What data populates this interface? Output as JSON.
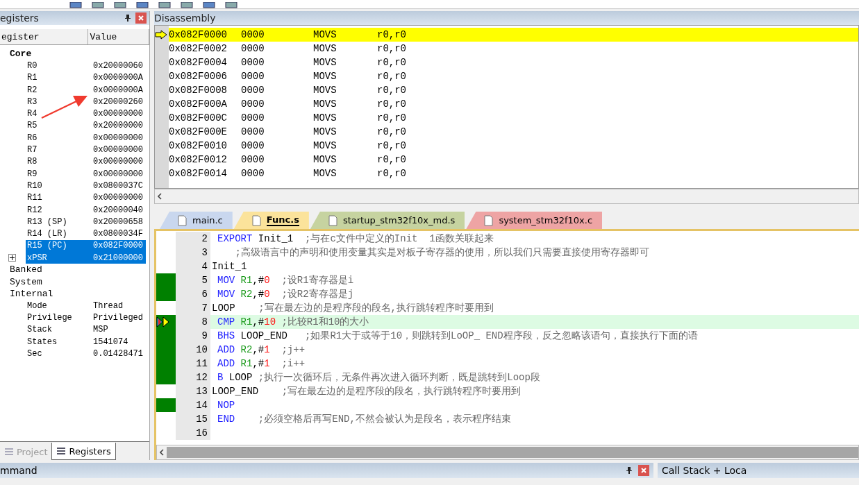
{
  "registers_panel": {
    "title": "egisters",
    "columns": [
      "egister",
      "Value"
    ],
    "groups": [
      {
        "name": "Core",
        "bold": true,
        "children": [
          {
            "name": "R0",
            "value": "0x20000060",
            "selected": false
          },
          {
            "name": "R1",
            "value": "0x0000000A",
            "selected": false
          },
          {
            "name": "R2",
            "value": "0x0000000A",
            "selected": false
          },
          {
            "name": "R3",
            "value": "0x20000260",
            "selected": false
          },
          {
            "name": "R4",
            "value": "0x00000000",
            "selected": false
          },
          {
            "name": "R5",
            "value": "0x20000000",
            "selected": false
          },
          {
            "name": "R6",
            "value": "0x00000000",
            "selected": false
          },
          {
            "name": "R7",
            "value": "0x00000000",
            "selected": false
          },
          {
            "name": "R8",
            "value": "0x00000000",
            "selected": false
          },
          {
            "name": "R9",
            "value": "0x00000000",
            "selected": false
          },
          {
            "name": "R10",
            "value": "0x0800037C",
            "selected": false
          },
          {
            "name": "R11",
            "value": "0x00000000",
            "selected": false
          },
          {
            "name": "R12",
            "value": "0x20000040",
            "selected": false
          },
          {
            "name": "R13 (SP)",
            "value": "0x20000658",
            "selected": false
          },
          {
            "name": "R14 (LR)",
            "value": "0x0800034F",
            "selected": false
          },
          {
            "name": "R15 (PC)",
            "value": "0x082F0000",
            "selected": true
          },
          {
            "name": "xPSR",
            "value": "0x21000000",
            "selected": true,
            "expanded": false
          }
        ]
      },
      {
        "name": "Banked",
        "bold": false
      },
      {
        "name": "System",
        "bold": false
      },
      {
        "name": "Internal",
        "bold": false,
        "children": [
          {
            "name": "Mode",
            "value": "Thread",
            "selected": false
          },
          {
            "name": "Privilege",
            "value": "Privileged",
            "selected": false
          },
          {
            "name": "Stack",
            "value": "MSP",
            "selected": false
          },
          {
            "name": "States",
            "value": "1541074",
            "selected": false
          },
          {
            "name": "Sec",
            "value": "0.01428471",
            "selected": false
          }
        ]
      }
    ],
    "tabs": [
      {
        "label": "Project",
        "selected": false,
        "disabled": true
      },
      {
        "label": "Registers",
        "selected": true,
        "disabled": false
      }
    ]
  },
  "disassembly": {
    "title": "Disassembly",
    "rows": [
      {
        "address": "0x082F0000",
        "code": "0000",
        "mnemonic": "MOVS",
        "operands": "r0,r0",
        "current": true
      },
      {
        "address": "0x082F0002",
        "code": "0000",
        "mnemonic": "MOVS",
        "operands": "r0,r0",
        "current": false
      },
      {
        "address": "0x082F0004",
        "code": "0000",
        "mnemonic": "MOVS",
        "operands": "r0,r0",
        "current": false
      },
      {
        "address": "0x082F0006",
        "code": "0000",
        "mnemonic": "MOVS",
        "operands": "r0,r0",
        "current": false
      },
      {
        "address": "0x082F0008",
        "code": "0000",
        "mnemonic": "MOVS",
        "operands": "r0,r0",
        "current": false
      },
      {
        "address": "0x082F000A",
        "code": "0000",
        "mnemonic": "MOVS",
        "operands": "r0,r0",
        "current": false
      },
      {
        "address": "0x082F000C",
        "code": "0000",
        "mnemonic": "MOVS",
        "operands": "r0,r0",
        "current": false
      },
      {
        "address": "0x082F000E",
        "code": "0000",
        "mnemonic": "MOVS",
        "operands": "r0,r0",
        "current": false
      },
      {
        "address": "0x082F0010",
        "code": "0000",
        "mnemonic": "MOVS",
        "operands": "r0,r0",
        "current": false
      },
      {
        "address": "0x082F0012",
        "code": "0000",
        "mnemonic": "MOVS",
        "operands": "r0,r0",
        "current": false
      },
      {
        "address": "0x082F0014",
        "code": "0000",
        "mnemonic": "MOVS",
        "operands": "r0,r0",
        "current": false
      }
    ]
  },
  "editor_tabs": [
    {
      "label": "main.c",
      "color": "#c9d7ee",
      "selected": false
    },
    {
      "label": "Func.s",
      "color": "#fbe39b",
      "selected": true
    },
    {
      "label": "startup_stm32f10x_md.s",
      "color": "#c6d3a0",
      "selected": false
    },
    {
      "label": "system_stm32f10x.c",
      "color": "#eea4a4",
      "selected": false
    }
  ],
  "editor": {
    "lines": [
      {
        "number": "2",
        "indented": true,
        "covered": false,
        "current": false,
        "segments": [
          {
            "kind": "keyword",
            "text": "EXPORT"
          },
          {
            "kind": "plain",
            "text": " Init_1  "
          },
          {
            "kind": "comment",
            "text": ";与在c文件中定义的Init  1函数关联起来"
          }
        ]
      },
      {
        "number": "3",
        "indented": false,
        "covered": false,
        "current": false,
        "segments": [
          {
            "kind": "comment",
            "text": "    ;高级语言中的声明和使用变量其实是对板子寄存器的使用，所以我们只需要直接使用寄存器即可"
          }
        ]
      },
      {
        "number": "4",
        "indented": false,
        "covered": false,
        "current": false,
        "segments": [
          {
            "kind": "plain",
            "text": "Init_1"
          }
        ]
      },
      {
        "number": "5",
        "indented": true,
        "covered": true,
        "current": false,
        "segments": [
          {
            "kind": "keyword",
            "text": "MOV"
          },
          {
            "kind": "register",
            "text": " R1"
          },
          {
            "kind": "plain",
            "text": ",#"
          },
          {
            "kind": "number",
            "text": "0"
          },
          {
            "kind": "comment",
            "text": "  ;设R1寄存器是i"
          }
        ]
      },
      {
        "number": "6",
        "indented": true,
        "covered": true,
        "current": false,
        "segments": [
          {
            "kind": "keyword",
            "text": "MOV"
          },
          {
            "kind": "register",
            "text": " R2"
          },
          {
            "kind": "plain",
            "text": ",#"
          },
          {
            "kind": "number",
            "text": "0"
          },
          {
            "kind": "comment",
            "text": "  ;设R2寄存器是j"
          }
        ]
      },
      {
        "number": "7",
        "indented": false,
        "covered": false,
        "current": false,
        "segments": [
          {
            "kind": "plain",
            "text": "LOOP    "
          },
          {
            "kind": "comment",
            "text": ";写在最左边的是程序段的段名,执行跳转程序时要用到"
          }
        ]
      },
      {
        "number": "8",
        "indented": true,
        "covered": true,
        "current": true,
        "segments": [
          {
            "kind": "keyword",
            "text": "CMP"
          },
          {
            "kind": "register",
            "text": " R1"
          },
          {
            "kind": "plain",
            "text": ",#"
          },
          {
            "kind": "number",
            "text": "10"
          },
          {
            "kind": "comment",
            "text": " ;比较R1和10的大小"
          }
        ]
      },
      {
        "number": "9",
        "indented": true,
        "covered": true,
        "current": false,
        "segments": [
          {
            "kind": "keyword",
            "text": "BHS"
          },
          {
            "kind": "plain",
            "text": " LOOP_END   "
          },
          {
            "kind": "comment",
            "text": ";如果R1大于或等于10，则跳转到LoOP_ END程序段，反之忽略该语句，直接执行下面的语"
          }
        ]
      },
      {
        "number": "10",
        "indented": true,
        "covered": true,
        "current": false,
        "segments": [
          {
            "kind": "keyword",
            "text": "ADD"
          },
          {
            "kind": "register",
            "text": " R2"
          },
          {
            "kind": "plain",
            "text": ",#"
          },
          {
            "kind": "number",
            "text": "1"
          },
          {
            "kind": "comment",
            "text": "  ;j++"
          }
        ]
      },
      {
        "number": "11",
        "indented": true,
        "covered": true,
        "current": false,
        "segments": [
          {
            "kind": "keyword",
            "text": "ADD"
          },
          {
            "kind": "register",
            "text": " R1"
          },
          {
            "kind": "plain",
            "text": ",#"
          },
          {
            "kind": "number",
            "text": "1"
          },
          {
            "kind": "comment",
            "text": "  ;i++"
          }
        ]
      },
      {
        "number": "12",
        "indented": true,
        "covered": true,
        "current": false,
        "segments": [
          {
            "kind": "keyword",
            "text": "B"
          },
          {
            "kind": "plain",
            "text": " LOOP "
          },
          {
            "kind": "comment",
            "text": ";执行一次循环后，无条件再次进入循环判断，既是跳转到Loop段"
          }
        ]
      },
      {
        "number": "13",
        "indented": false,
        "covered": false,
        "current": false,
        "segments": [
          {
            "kind": "plain",
            "text": "LOOP_END    "
          },
          {
            "kind": "comment",
            "text": ";写在最左边的是程序段的段名，执行跳转程序时要用到"
          }
        ]
      },
      {
        "number": "14",
        "indented": true,
        "covered": true,
        "current": false,
        "segments": [
          {
            "kind": "keyword",
            "text": "NOP"
          }
        ]
      },
      {
        "number": "15",
        "indented": true,
        "covered": false,
        "current": false,
        "segments": [
          {
            "kind": "keyword",
            "text": "END"
          },
          {
            "kind": "comment",
            "text": "    ;必须空格后再写END,不然会被认为是段名，表示程序结束"
          }
        ]
      },
      {
        "number": "16",
        "covered": false,
        "current": false
      }
    ]
  },
  "bottom_panels": [
    {
      "title": "mmand"
    },
    {
      "title": "Call Stack + Loca"
    }
  ]
}
